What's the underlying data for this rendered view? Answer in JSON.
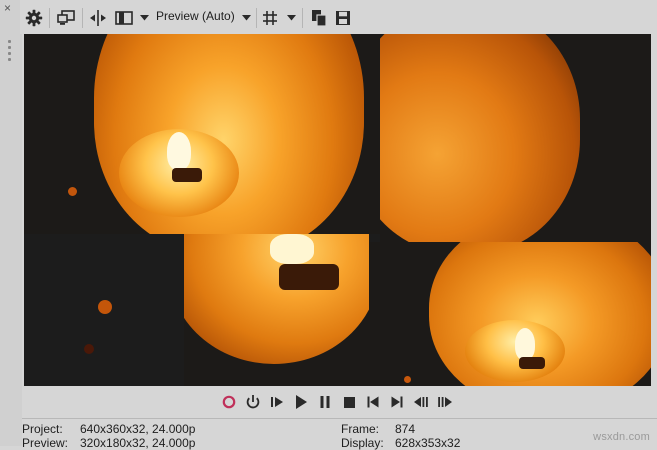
{
  "window": {
    "close_glyph": "×"
  },
  "toolbar": {
    "view_mode": "Preview (Auto)",
    "icons": [
      "gear-icon",
      "external-monitor-icon",
      "split-screen-icon",
      "overlay-icon",
      "chevron-down-icon",
      "grid-icon",
      "copy-snapshot-icon",
      "save-snapshot-icon"
    ]
  },
  "transport": {
    "buttons": [
      "record",
      "loop-playback",
      "play-from-start",
      "play",
      "pause",
      "stop",
      "previous-frame-start",
      "go-to-end",
      "previous-frame",
      "next-frame"
    ],
    "record_color": "#c0305a"
  },
  "status": {
    "project_label": "Project:",
    "project_value": "640x360x32, 24.000p",
    "preview_label": "Preview:",
    "preview_value": "320x180x32, 24.000p",
    "frame_label": "Frame:",
    "frame_value": "874",
    "display_label": "Display:",
    "display_value": "628x353x32"
  },
  "watermark": "wsxdn.com",
  "colors": {
    "lantern_core": "#ffd36a",
    "lantern_edge": "#c85a06",
    "background": "#1c1c1c"
  }
}
